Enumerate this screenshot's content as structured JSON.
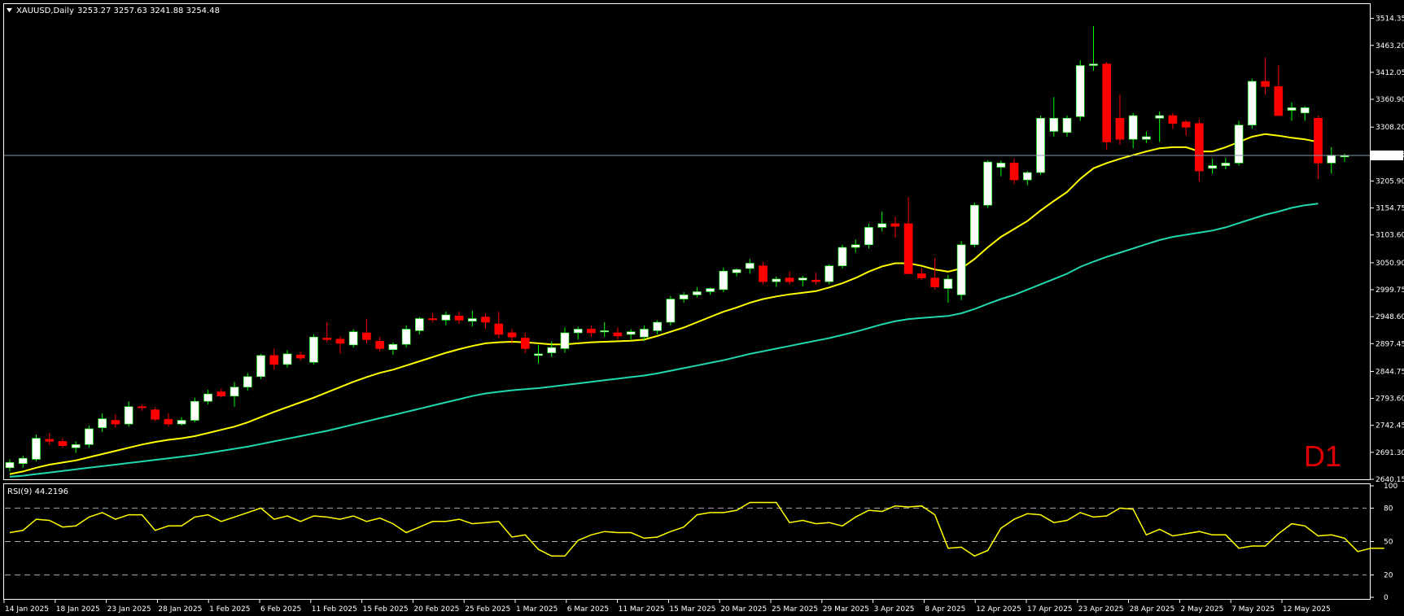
{
  "header": {
    "symbol": "XAUUSD,Daily",
    "ohlc": "3253.27 3257.63 3241.88 3254.48",
    "dropdown_icon": "triangle-down-icon"
  },
  "timeframe_label": "D1",
  "current_price_label": "3254.48",
  "rsi_label": "RSI(9) 44.2196",
  "colors": {
    "background": "#000000",
    "frame": "#ffffff",
    "bull_candle": "#ffffff",
    "bear_candle": "#ff0000",
    "wick_bull": "#00ff00",
    "ma_fast": "#ffff00",
    "ma_slow": "#20d8b0",
    "rsi_line": "#ffff00",
    "price_line": "#8899aa",
    "level_dash": "#aaaaaa",
    "timeframe_label": "#e00000"
  },
  "chart_data": [
    {
      "type": "candlestick",
      "title": "XAUUSD,Daily",
      "ylim": [
        2640.15,
        3540
      ],
      "y_ticks": [
        "3514.35",
        "3463.20",
        "3412.05",
        "3360.90",
        "3308.20",
        "3257.05",
        "3205.90",
        "3154.75",
        "3103.60",
        "3050.90",
        "2999.75",
        "2948.60",
        "2897.45",
        "2844.75",
        "2793.60",
        "2742.45",
        "2691.30",
        "2640.15"
      ],
      "x_ticks": [
        "14 Jan 2025",
        "18 Jan 2025",
        "23 Jan 2025",
        "28 Jan 2025",
        "1 Feb 2025",
        "6 Feb 2025",
        "11 Feb 2025",
        "15 Feb 2025",
        "20 Feb 2025",
        "25 Feb 2025",
        "1 Mar 2025",
        "6 Mar 2025",
        "11 Mar 2025",
        "15 Mar 2025",
        "20 Mar 2025",
        "25 Mar 2025",
        "29 Mar 2025",
        "3 Apr 2025",
        "8 Apr 2025",
        "12 Apr 2025",
        "17 Apr 2025",
        "23 Apr 2025",
        "28 Apr 2025",
        "2 May 2025",
        "7 May 2025",
        "12 May 2025"
      ],
      "candles": [
        [
          2662,
          2678,
          2655,
          2672
        ],
        [
          2670,
          2685,
          2662,
          2680
        ],
        [
          2678,
          2725,
          2674,
          2718
        ],
        [
          2716,
          2728,
          2705,
          2712
        ],
        [
          2712,
          2718,
          2700,
          2704
        ],
        [
          2700,
          2712,
          2690,
          2706
        ],
        [
          2706,
          2742,
          2700,
          2736
        ],
        [
          2738,
          2765,
          2730,
          2755
        ],
        [
          2752,
          2764,
          2738,
          2745
        ],
        [
          2745,
          2788,
          2740,
          2778
        ],
        [
          2778,
          2782,
          2770,
          2776
        ],
        [
          2772,
          2777,
          2750,
          2754
        ],
        [
          2754,
          2766,
          2740,
          2745
        ],
        [
          2745,
          2758,
          2742,
          2752
        ],
        [
          2752,
          2795,
          2748,
          2788
        ],
        [
          2788,
          2810,
          2782,
          2802
        ],
        [
          2806,
          2812,
          2795,
          2798
        ],
        [
          2798,
          2825,
          2778,
          2815
        ],
        [
          2815,
          2842,
          2808,
          2835
        ],
        [
          2835,
          2878,
          2830,
          2875
        ],
        [
          2875,
          2888,
          2848,
          2858
        ],
        [
          2858,
          2885,
          2852,
          2878
        ],
        [
          2876,
          2882,
          2865,
          2870
        ],
        [
          2862,
          2915,
          2858,
          2910
        ],
        [
          2908,
          2938,
          2900,
          2905
        ],
        [
          2906,
          2912,
          2878,
          2898
        ],
        [
          2895,
          2925,
          2890,
          2920
        ],
        [
          2918,
          2945,
          2898,
          2905
        ],
        [
          2902,
          2910,
          2882,
          2888
        ],
        [
          2886,
          2900,
          2876,
          2896
        ],
        [
          2896,
          2932,
          2890,
          2925
        ],
        [
          2922,
          2948,
          2915,
          2945
        ],
        [
          2945,
          2956,
          2938,
          2943
        ],
        [
          2942,
          2958,
          2932,
          2952
        ],
        [
          2950,
          2958,
          2935,
          2942
        ],
        [
          2940,
          2960,
          2930,
          2945
        ],
        [
          2948,
          2955,
          2925,
          2938
        ],
        [
          2935,
          2958,
          2908,
          2915
        ],
        [
          2918,
          2925,
          2898,
          2910
        ],
        [
          2908,
          2918,
          2880,
          2888
        ],
        [
          2875,
          2895,
          2860,
          2878
        ],
        [
          2880,
          2902,
          2872,
          2890
        ],
        [
          2888,
          2928,
          2880,
          2918
        ],
        [
          2918,
          2930,
          2905,
          2925
        ],
        [
          2925,
          2932,
          2910,
          2918
        ],
        [
          2920,
          2938,
          2910,
          2922
        ],
        [
          2918,
          2928,
          2905,
          2912
        ],
        [
          2915,
          2925,
          2905,
          2920
        ],
        [
          2910,
          2932,
          2902,
          2925
        ],
        [
          2922,
          2942,
          2915,
          2938
        ],
        [
          2938,
          2988,
          2932,
          2982
        ],
        [
          2982,
          2995,
          2975,
          2990
        ],
        [
          2990,
          3005,
          2985,
          2996
        ],
        [
          2996,
          3004,
          2990,
          3002
        ],
        [
          3000,
          3042,
          2995,
          3035
        ],
        [
          3032,
          3040,
          3025,
          3038
        ],
        [
          3040,
          3058,
          3030,
          3050
        ],
        [
          3045,
          3052,
          3010,
          3015
        ],
        [
          3015,
          3025,
          3005,
          3020
        ],
        [
          3022,
          3035,
          3010,
          3015
        ],
        [
          3018,
          3026,
          3006,
          3022
        ],
        [
          3018,
          3032,
          3010,
          3015
        ],
        [
          3015,
          3048,
          3010,
          3045
        ],
        [
          3045,
          3085,
          3040,
          3080
        ],
        [
          3080,
          3095,
          3070,
          3085
        ],
        [
          3085,
          3125,
          3078,
          3118
        ],
        [
          3118,
          3148,
          3110,
          3125
        ],
        [
          3125,
          3138,
          3098,
          3120
        ],
        [
          3125,
          3175,
          3052,
          3030
        ],
        [
          3030,
          3040,
          3018,
          3022
        ],
        [
          3022,
          3060,
          3000,
          3005
        ],
        [
          3002,
          3028,
          2975,
          3020
        ],
        [
          2990,
          3092,
          2980,
          3085
        ],
        [
          3085,
          3165,
          3080,
          3160
        ],
        [
          3160,
          3245,
          3155,
          3242
        ],
        [
          3232,
          3245,
          3215,
          3240
        ],
        [
          3240,
          3248,
          3200,
          3208
        ],
        [
          3208,
          3225,
          3198,
          3222
        ],
        [
          3222,
          3330,
          3218,
          3325
        ],
        [
          3300,
          3365,
          3290,
          3325
        ],
        [
          3298,
          3330,
          3290,
          3325
        ],
        [
          3328,
          3435,
          3320,
          3425
        ],
        [
          3425,
          3500,
          3415,
          3428
        ],
        [
          3428,
          3432,
          3265,
          3280
        ],
        [
          3325,
          3370,
          3275,
          3285
        ],
        [
          3285,
          3335,
          3268,
          3330
        ],
        [
          3285,
          3300,
          3278,
          3290
        ],
        [
          3325,
          3338,
          3280,
          3330
        ],
        [
          3330,
          3335,
          3305,
          3315
        ],
        [
          3318,
          3322,
          3292,
          3308
        ],
        [
          3315,
          3322,
          3205,
          3225
        ],
        [
          3230,
          3248,
          3220,
          3235
        ],
        [
          3235,
          3250,
          3228,
          3240
        ],
        [
          3240,
          3320,
          3235,
          3312
        ],
        [
          3312,
          3400,
          3305,
          3395
        ],
        [
          3395,
          3440,
          3370,
          3385
        ],
        [
          3385,
          3425,
          3330,
          3330
        ],
        [
          3340,
          3355,
          3320,
          3345
        ],
        [
          3335,
          3348,
          3320,
          3345
        ],
        [
          3325,
          3330,
          3210,
          3240
        ],
        [
          3240,
          3270,
          3220,
          3255
        ],
        [
          3253,
          3258,
          3242,
          3254
        ]
      ],
      "series": [
        {
          "name": "",
          "kind": "ma",
          "values": [
            2650,
            2655,
            2662,
            2668,
            2672,
            2676,
            2682,
            2688,
            2694,
            2700,
            2706,
            2711,
            2715,
            2718,
            2722,
            2728,
            2734,
            2740,
            2748,
            2758,
            2768,
            2777,
            2786,
            2795,
            2805,
            2815,
            2825,
            2834,
            2842,
            2848,
            2856,
            2864,
            2872,
            2880,
            2887,
            2893,
            2898,
            2900,
            2901,
            2900,
            2898,
            2896,
            2896,
            2898,
            2900,
            2901,
            2902,
            2903,
            2905,
            2912,
            2920,
            2928,
            2938,
            2948,
            2958,
            2966,
            2975,
            2982,
            2987,
            2991,
            2994,
            2997,
            3004,
            3012,
            3022,
            3034,
            3044,
            3050,
            3050,
            3045,
            3038,
            3034,
            3040,
            3058,
            3080,
            3100,
            3115,
            3130,
            3150,
            3168,
            3185,
            3210,
            3230,
            3240,
            3248,
            3255,
            3262,
            3268,
            3270,
            3270,
            3262,
            3262,
            3270,
            3280,
            3290,
            3295,
            3292,
            3288,
            3285,
            3280
          ]
        },
        {
          "name": "",
          "kind": "ma",
          "values": [
            2645,
            2647,
            2650,
            2653,
            2656,
            2659,
            2662,
            2665,
            2668,
            2671,
            2674,
            2677,
            2680,
            2683,
            2686,
            2690,
            2694,
            2698,
            2702,
            2707,
            2712,
            2717,
            2722,
            2727,
            2732,
            2738,
            2744,
            2750,
            2756,
            2762,
            2768,
            2774,
            2780,
            2786,
            2792,
            2798,
            2803,
            2806,
            2809,
            2811,
            2813,
            2816,
            2819,
            2822,
            2825,
            2828,
            2831,
            2834,
            2837,
            2841,
            2846,
            2851,
            2856,
            2861,
            2866,
            2872,
            2878,
            2883,
            2888,
            2893,
            2898,
            2903,
            2908,
            2914,
            2920,
            2927,
            2934,
            2940,
            2944,
            2946,
            2948,
            2950,
            2955,
            2963,
            2973,
            2982,
            2990,
            3000,
            3010,
            3020,
            3030,
            3043,
            3053,
            3062,
            3070,
            3078,
            3086,
            3094,
            3100,
            3104,
            3108,
            3112,
            3118,
            3126,
            3134,
            3142,
            3148,
            3155,
            3160,
            3163
          ]
        }
      ]
    },
    {
      "type": "line",
      "title": "RSI(9) 44.2196",
      "ylim": [
        0,
        100
      ],
      "y_ticks": [
        "100",
        "80",
        "50",
        "20",
        "0"
      ],
      "levels": [
        80,
        50,
        20
      ],
      "series": [
        {
          "name": "",
          "values": [
            58,
            60,
            70,
            69,
            63,
            64,
            72,
            76,
            70,
            74,
            74,
            60,
            64,
            64,
            72,
            74,
            68,
            72,
            76,
            80,
            70,
            73,
            68,
            73,
            72,
            70,
            73,
            68,
            71,
            66,
            58,
            63,
            68,
            68,
            70,
            66,
            67,
            68,
            54,
            56,
            43,
            37,
            37,
            51,
            56,
            59,
            58,
            58,
            53,
            54,
            59,
            63,
            74,
            76,
            76,
            78,
            85,
            85,
            85,
            67,
            69,
            66,
            67,
            64,
            72,
            78,
            77,
            82,
            81,
            82,
            74,
            44,
            45,
            37,
            42,
            62,
            70,
            75,
            74,
            67,
            69,
            76,
            72,
            73,
            80,
            79,
            56,
            61,
            55,
            57,
            59,
            56,
            56,
            44,
            46,
            46,
            57,
            66,
            64,
            55,
            56,
            53,
            41,
            44,
            44
          ]
        }
      ]
    }
  ]
}
